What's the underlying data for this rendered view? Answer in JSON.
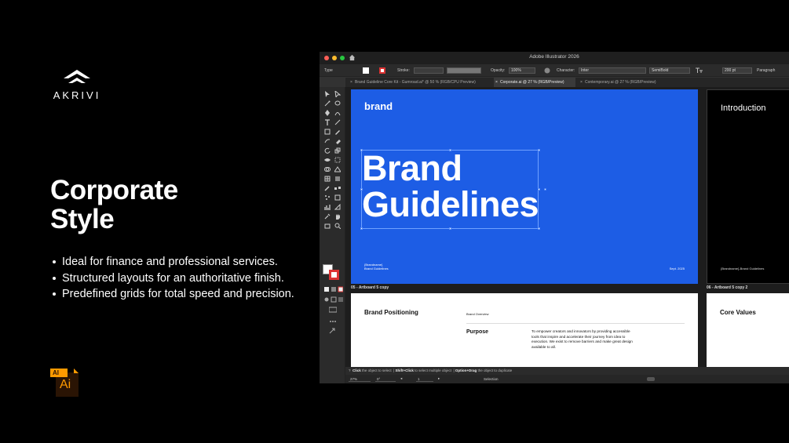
{
  "slide": {
    "logo_text": "AKRIVI",
    "headline_line1": "Corporate",
    "headline_line2": "Style",
    "bullets": [
      "Ideal for finance and professional services.",
      "Structured layouts for an authoritative finish.",
      "Predefined grids for total speed and precision."
    ],
    "ai_icon_tag": "AI",
    "ai_icon_label": "Ai"
  },
  "app": {
    "title": "Adobe Illustrator 2026",
    "control_bar": {
      "type_label": "Type",
      "stroke_label": "Stroke:",
      "opacity_label": "Opacity:",
      "opacity_value": "100%",
      "character_label": "Character:",
      "font_family": "Inter",
      "font_weight": "SemiBold",
      "font_size": "200 pt",
      "paragraph_label": "Paragraph"
    },
    "tabs": [
      {
        "label": "Brand Guideline Core Kit - Gumroad.ai* @ 50 % (RGB/CPU Preview)"
      },
      {
        "label": "Corporate.ai @ 27 % (RGB/Preview)"
      },
      {
        "label": "Contemporary.ai @ 27 % (RGB/Preview)"
      }
    ],
    "colors": {
      "artboard_blue": "#1d5de5",
      "stroke_red": "#dd3333"
    }
  },
  "artboards": {
    "cover": {
      "brand_word": "brand",
      "title_line1": "Brand",
      "title_line2": "Guidelines",
      "foot_line1": "{Brandname}",
      "foot_line2": "Brand Guidelines",
      "date": "Sept. 2025"
    },
    "intro": {
      "title": "Introduction",
      "foot": "{Brandname}-Brand Guidelines"
    },
    "label_5": "05 - Artboard 5 copy",
    "label_6": "06 - Artboard 5 copy 2",
    "positioning": {
      "title": "Brand Positioning",
      "overview": "Brand Overview",
      "purpose_label": "Purpose",
      "purpose_text": "To empower creators and innovators by providing accessible tools that inspire and accelerate their journey from idea to execution. We exist to remove barriers and make great design available to all."
    },
    "core_values": {
      "title": "Core Values"
    }
  },
  "status": {
    "click_key": "Click",
    "click_text": "the object to select",
    "shift_key": "Shift+Click",
    "shift_text": "to select multiple object",
    "option_key": "Option+Drag",
    "option_text": "the object to duplicate"
  },
  "bottom": {
    "zoom": "27%",
    "rotation": "0°",
    "artboard_num": "1",
    "tool_name": "Selection"
  }
}
